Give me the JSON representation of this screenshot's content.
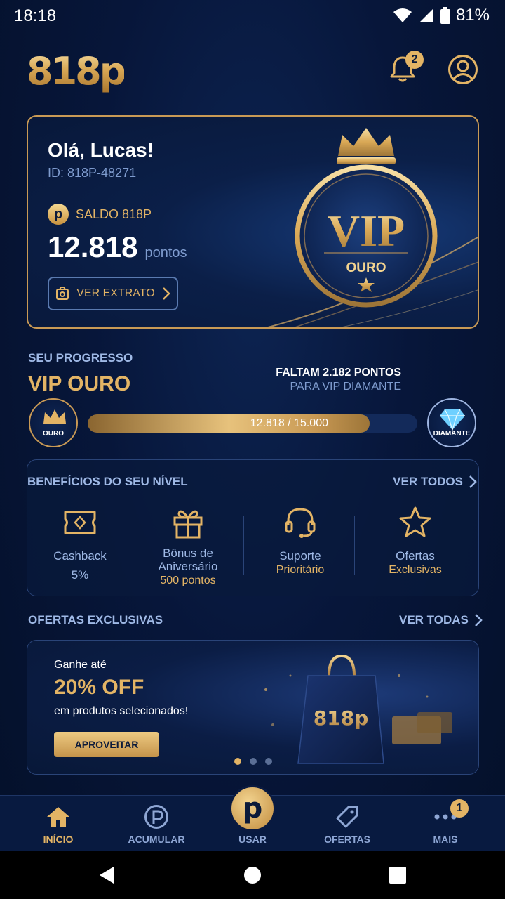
{
  "status_bar": {
    "time": "18:18",
    "battery": "81%"
  },
  "header": {
    "logo": "818p",
    "notification_count": "2"
  },
  "hero": {
    "greeting": "Olá, Lucas!",
    "user_id": "ID: 818P-48271",
    "coin_glyph": "p",
    "balance_label": "SALDO 818P",
    "points": "12.818",
    "points_unit": "pontos",
    "statement_button": "VER EXTRATO",
    "vip_text": "VIP",
    "vip_tier": "OURO"
  },
  "progress": {
    "label": "SEU PROGRESSO",
    "level": "VIP OURO",
    "remaining_line1": "FALTAM 2.182 PONTOS",
    "remaining_line2": "PARA VIP DIAMANTE",
    "current_tier": "OURO",
    "next_tier": "DIAMANTE",
    "bar_text": "12.818 / 15.000",
    "fraction": 0.8545
  },
  "benefits": {
    "title": "BENEFÍCIOS DO SEU NÍVEL",
    "see_all": "VER TODOS",
    "items": [
      {
        "icon": "ticket-icon",
        "line1": "Cashback",
        "line2": "5%"
      },
      {
        "icon": "gift-icon",
        "line1": "Bônus de Aniversário",
        "line2": "500 pontos"
      },
      {
        "icon": "headset-icon",
        "line1": "Suporte",
        "line2": "Prioritário"
      },
      {
        "icon": "star-icon",
        "line1": "Ofertas",
        "line2": "Exclusivas"
      }
    ]
  },
  "offers": {
    "title": "OFERTAS EXCLUSIVAS",
    "see_all": "VER TODAS",
    "banner": {
      "small": "Ganhe até",
      "big": "20% OFF",
      "desc": "em produtos selecionados!",
      "cta": "APROVEITAR",
      "bag_logo": "818p"
    }
  },
  "bottom_nav": {
    "items": [
      {
        "label": "INÍCIO",
        "icon": "home-icon"
      },
      {
        "label": "ACUMULAR",
        "icon": "coin-icon"
      },
      {
        "label": "USAR",
        "icon": "p-logo-icon",
        "glyph": "p"
      },
      {
        "label": "OFERTAS",
        "icon": "tag-icon"
      },
      {
        "label": "MAIS",
        "icon": "more-icon",
        "badge": "1"
      }
    ]
  },
  "colors": {
    "gold": "#e3b465",
    "navy": "#07163a",
    "muted_blue": "#9fb9e6"
  }
}
